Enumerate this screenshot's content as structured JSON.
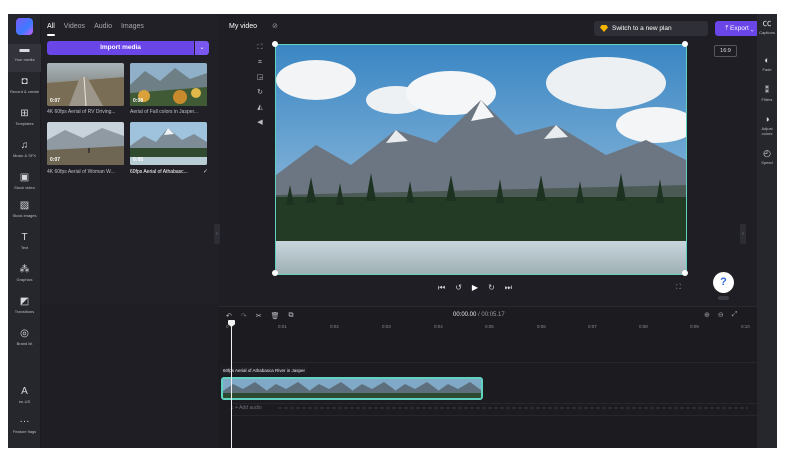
{
  "rail": {
    "items": [
      {
        "label": "Your media",
        "icon": "folder-icon",
        "glyph": "▬"
      },
      {
        "label": "Record & create",
        "icon": "record-icon",
        "glyph": "◘"
      },
      {
        "label": "Templates",
        "icon": "templates-icon",
        "glyph": "⊞"
      },
      {
        "label": "Music & SFX",
        "icon": "music-icon",
        "glyph": "♫"
      },
      {
        "label": "Stock video",
        "icon": "stock-video-icon",
        "glyph": "▣"
      },
      {
        "label": "Stock images",
        "icon": "stock-images-icon",
        "glyph": "▨"
      },
      {
        "label": "Text",
        "icon": "text-icon",
        "glyph": "T"
      },
      {
        "label": "Graphics",
        "icon": "graphics-icon",
        "glyph": "⁂"
      },
      {
        "label": "Transitions",
        "icon": "transitions-icon",
        "glyph": "◩"
      },
      {
        "label": "Brand kit",
        "icon": "brand-kit-icon",
        "glyph": "◎"
      }
    ],
    "bottom": [
      {
        "label": "en-US",
        "icon": "language-icon",
        "glyph": "A"
      },
      {
        "label": "Feature flags",
        "icon": "more-icon",
        "glyph": "···"
      }
    ]
  },
  "media": {
    "tabs": [
      "All",
      "Videos",
      "Audio",
      "Images"
    ],
    "import_label": "Import media",
    "import_dropdown": "⌄",
    "items": [
      {
        "duration": "0:07",
        "title": "4K 60fps Aerial of RV Driving..."
      },
      {
        "duration": "0:08",
        "title": "Aerial of Fall colors in Jasper..."
      },
      {
        "duration": "0:07",
        "title": "4K 60fps Aerial of Woman W..."
      },
      {
        "duration": "0:05",
        "title": "60fps Aerial of Athabasc...",
        "check": "✓"
      }
    ]
  },
  "topbar": {
    "title": "My video",
    "plan_label": "Switch to a new plan",
    "export_label": "Export",
    "export_arrow": "⌄"
  },
  "preview": {
    "ratio": "16:9",
    "help": "?"
  },
  "right_rail": [
    {
      "label": "Captions",
      "glyph": "㏄"
    },
    {
      "label": "Fade",
      "glyph": "◐"
    },
    {
      "label": "Filters",
      "glyph": "⁑"
    },
    {
      "label": "Adjust colors",
      "glyph": "◑"
    },
    {
      "label": "Speed",
      "glyph": "◴"
    }
  ],
  "timeline": {
    "timecode_current": "00:00.00",
    "timecode_sep": " / ",
    "timecode_total": "00:05.17",
    "ticks": [
      "0",
      "0:01",
      "0:02",
      "0:03",
      "0:04",
      "0:05",
      "0:06",
      "0:07",
      "0:08",
      "0:09",
      "0:10"
    ],
    "clip_label": "60fps Aerial of Athabasca River in Jasper",
    "audio_label": "♫ + Add audio"
  },
  "colors": {
    "accent": "#6a45e8",
    "selection": "#5fd3c0",
    "plan_gem": "#f5b400"
  }
}
